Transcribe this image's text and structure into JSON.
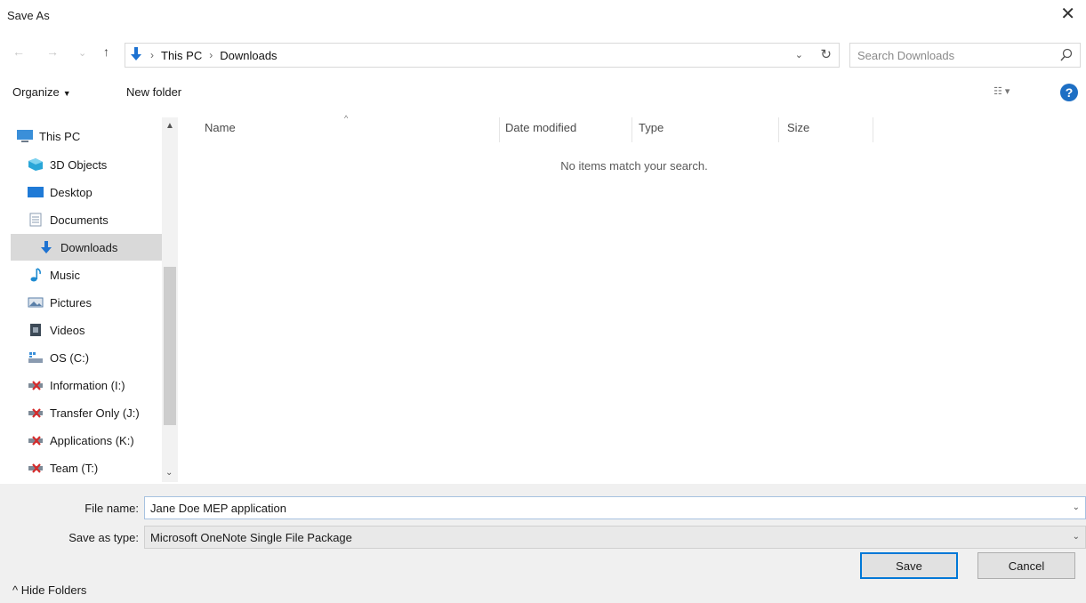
{
  "window": {
    "title": "Save As",
    "close_glyph": "✕"
  },
  "nav": {
    "back": "←",
    "forward": "→",
    "recent": "⌄",
    "up": "↑"
  },
  "address": {
    "crumbs": [
      "This PC",
      "Downloads"
    ],
    "separator": "›",
    "dropdown": "⌄",
    "refresh": "↻"
  },
  "search": {
    "placeholder": "Search Downloads",
    "icon": "search-icon"
  },
  "toolbar": {
    "organize": "Organize",
    "organize_caret": "▼",
    "new_folder": "New folder",
    "view_glyph": "☷ ▾",
    "help_glyph": "?"
  },
  "sidebar": {
    "items": [
      {
        "label": "This PC",
        "icon": "computer-icon",
        "color": "#3a8fd9"
      },
      {
        "label": "3D Objects",
        "icon": "cube-icon",
        "color": "#29a6d8"
      },
      {
        "label": "Desktop",
        "icon": "desktop-folder-icon",
        "color": "#1f7ad6"
      },
      {
        "label": "Documents",
        "icon": "document-icon",
        "color": "#8a9bb0"
      },
      {
        "label": "Downloads",
        "icon": "download-arrow-icon",
        "color": "#1d72d1",
        "selected": true
      },
      {
        "label": "Music",
        "icon": "music-note-icon",
        "color": "#1d8ad1"
      },
      {
        "label": "Pictures",
        "icon": "pictures-icon",
        "color": "#5a7fa8"
      },
      {
        "label": "Videos",
        "icon": "film-icon",
        "color": "#3d4a57"
      },
      {
        "label": "OS (C:)",
        "icon": "drive-icon",
        "color": "#3a8fd9"
      },
      {
        "label": "Information (I:)",
        "icon": "network-drive-disconnected-icon",
        "color": "#d62b2b"
      },
      {
        "label": "Transfer Only (J:)",
        "icon": "network-drive-disconnected-icon",
        "color": "#d62b2b"
      },
      {
        "label": "Applications (K:)",
        "icon": "network-drive-disconnected-icon",
        "color": "#d62b2b"
      },
      {
        "label": "Team (T:)",
        "icon": "network-drive-disconnected-icon",
        "color": "#d62b2b"
      }
    ],
    "scroll_up": "▲",
    "scroll_down": "⌄"
  },
  "columns": [
    "Name",
    "Date modified",
    "Type",
    "Size"
  ],
  "sort_indicator": "^",
  "empty_message": "No items match your search.",
  "form": {
    "file_name_label": "File name:",
    "file_name_value": "Jane Doe MEP application",
    "save_type_label": "Save as type:",
    "save_type_value": "Microsoft OneNote Single File Package",
    "dropdown_glyph": "⌄"
  },
  "footer": {
    "hide_folders": "^  Hide Folders",
    "save": "Save",
    "cancel": "Cancel"
  },
  "colors": {
    "accent": "#0078d7",
    "selected_bg": "#d9d9d9",
    "panel_bg": "#f0f0f0",
    "help_blue": "#1e6fc4"
  }
}
